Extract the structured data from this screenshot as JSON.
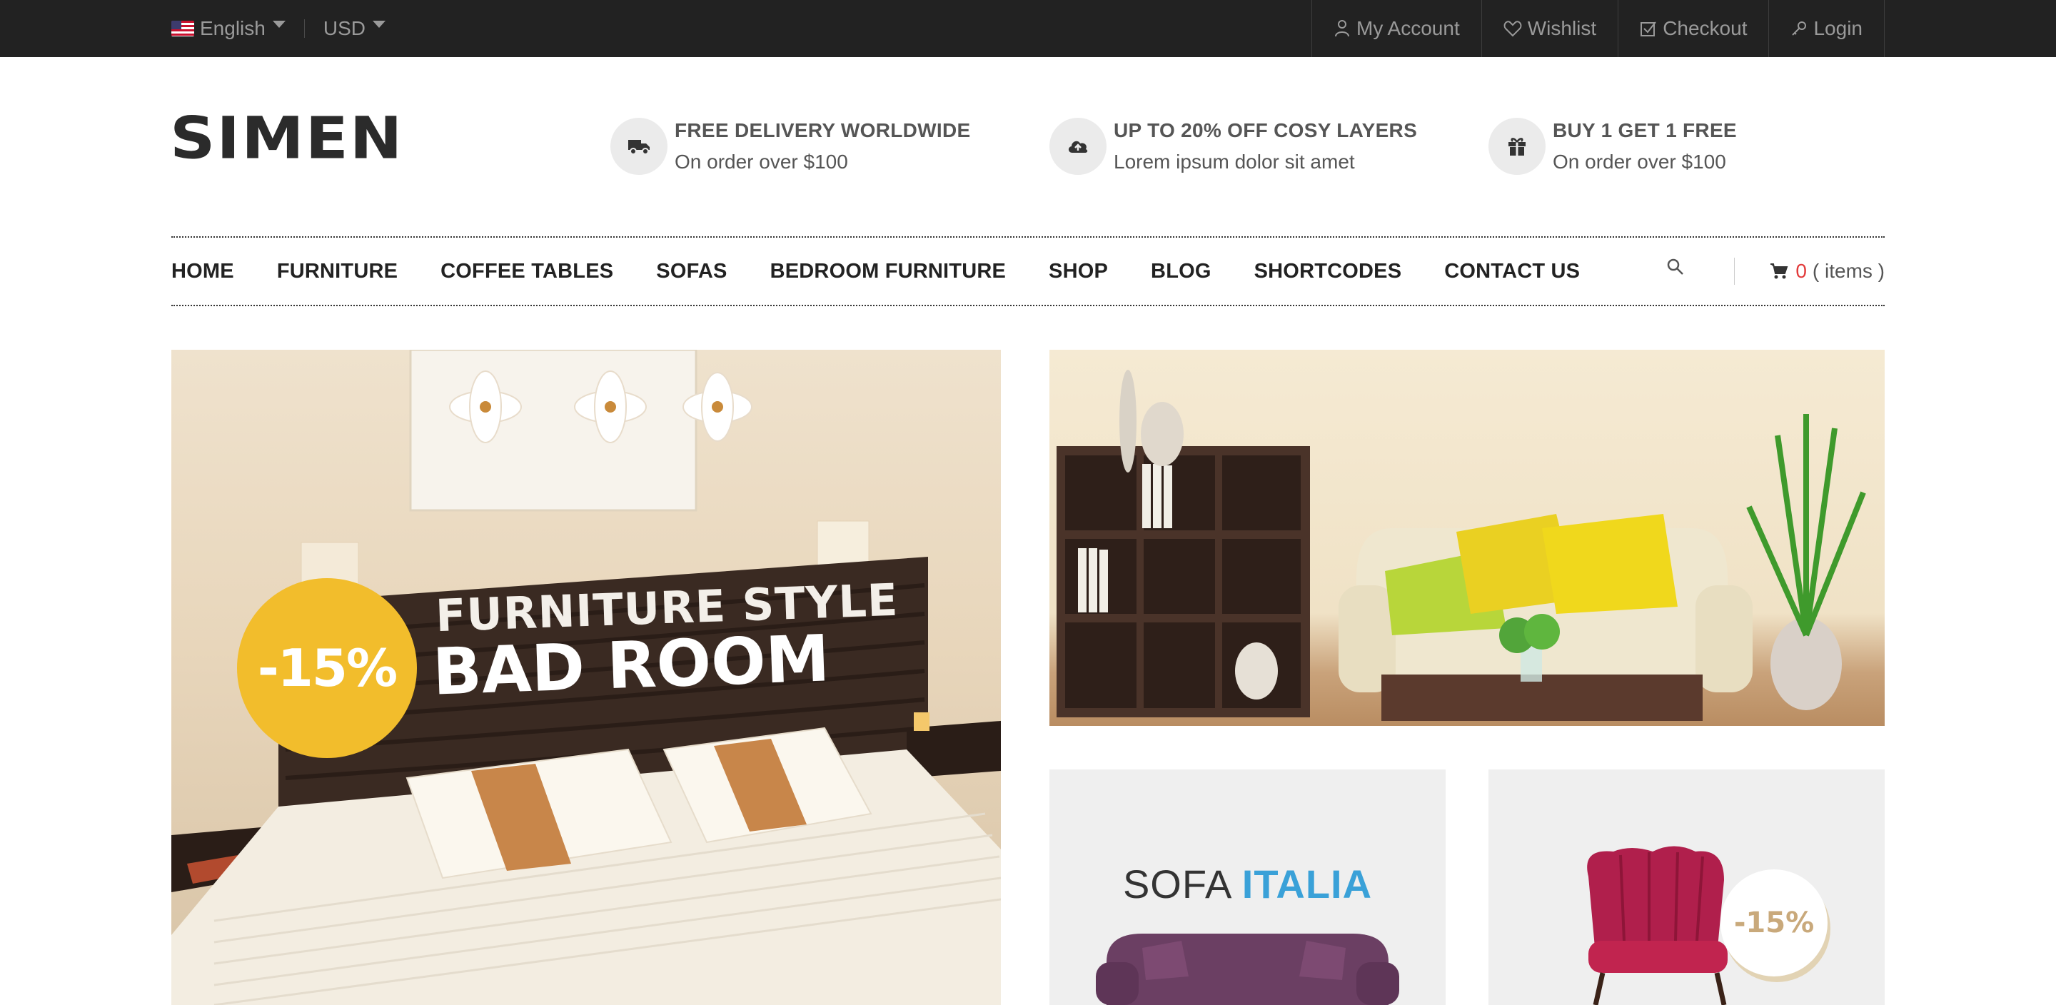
{
  "topbar": {
    "language": "English",
    "currency": "USD",
    "links": [
      "My Account",
      "Wishlist",
      "Checkout",
      "Login"
    ]
  },
  "header": {
    "logo": "SIMEN",
    "features": [
      {
        "icon": "truck-icon",
        "title": "FREE DELIVERY WORLDWIDE",
        "subtitle": "On order over $100"
      },
      {
        "icon": "cloud-upload-icon",
        "title": "UP TO 20% OFF COSY LAYERS",
        "subtitle": "Lorem ipsum dolor sit amet"
      },
      {
        "icon": "gift-icon",
        "title": "BUY 1 GET 1 FREE",
        "subtitle": "On order over $100"
      }
    ]
  },
  "nav": {
    "items": [
      "HOME",
      "FURNITURE",
      "COFFEE TABLES",
      "SOFAS",
      "BEDROOM FURNITURE",
      "SHOP",
      "BLOG",
      "SHORTCODES",
      "CONTACT US"
    ],
    "cart_count": "0",
    "cart_label": "( items )"
  },
  "banners": {
    "bedroom": {
      "badge": "-15%",
      "title_line1": "FURNITURE STYLE",
      "title_line2": "BAD ROOM"
    },
    "italia": {
      "word1": "SOFA",
      "word2": "ITALIA"
    },
    "chair": {
      "badge": "-15%"
    }
  },
  "colors": {
    "topbar_bg": "#222222",
    "badge_yellow": "#f2bd2c",
    "italia_blue": "#3aa1d8",
    "cart_count_red": "#e23b3b"
  }
}
